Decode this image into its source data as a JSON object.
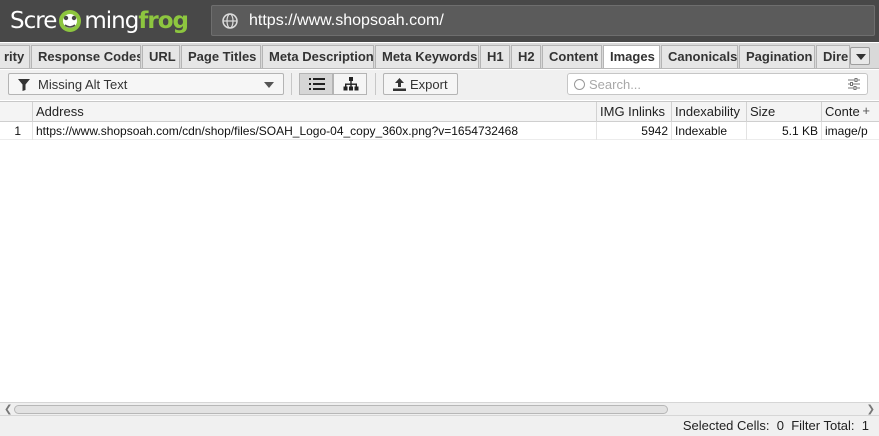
{
  "app": {
    "logo_part1": "Scre",
    "logo_part2": "ming",
    "logo_part3": "frog",
    "url": "https://www.shopsoah.com/",
    "url_icon": "globe-icon"
  },
  "tabs": [
    {
      "label": "rity",
      "active": false
    },
    {
      "label": "Response Codes",
      "active": false
    },
    {
      "label": "URL",
      "active": false
    },
    {
      "label": "Page Titles",
      "active": false
    },
    {
      "label": "Meta Description",
      "active": false
    },
    {
      "label": "Meta Keywords",
      "active": false
    },
    {
      "label": "H1",
      "active": false
    },
    {
      "label": "H2",
      "active": false
    },
    {
      "label": "Content",
      "active": false
    },
    {
      "label": "Images",
      "active": true
    },
    {
      "label": "Canonicals",
      "active": false
    },
    {
      "label": "Pagination",
      "active": false
    },
    {
      "label": "Dire",
      "active": false
    }
  ],
  "toolbar": {
    "filter_icon": "filter-icon",
    "filter_value": "Missing Alt Text",
    "list_view_icon": "list-icon",
    "tree_view_icon": "tree-icon",
    "export_label": "Export",
    "export_icon": "upload-icon",
    "search_placeholder": "Search...",
    "search_options_icon": "sliders-icon"
  },
  "table": {
    "columns": [
      "Address",
      "IMG Inlinks",
      "Indexability",
      "Size",
      "Conte"
    ],
    "rows": [
      {
        "index": "1",
        "address": "https://www.shopsoah.com/cdn/shop/files/SOAH_Logo-04_copy_360x.png?v=1654732468",
        "img_inlinks": "5942",
        "indexability": "Indexable",
        "size": "5.1 KB",
        "content": "image/p"
      }
    ]
  },
  "status": {
    "text": "Selected Cells:  0  Filter Total:  1"
  },
  "colors": {
    "topbar": "#484848",
    "brand_green": "#8dc63f"
  }
}
